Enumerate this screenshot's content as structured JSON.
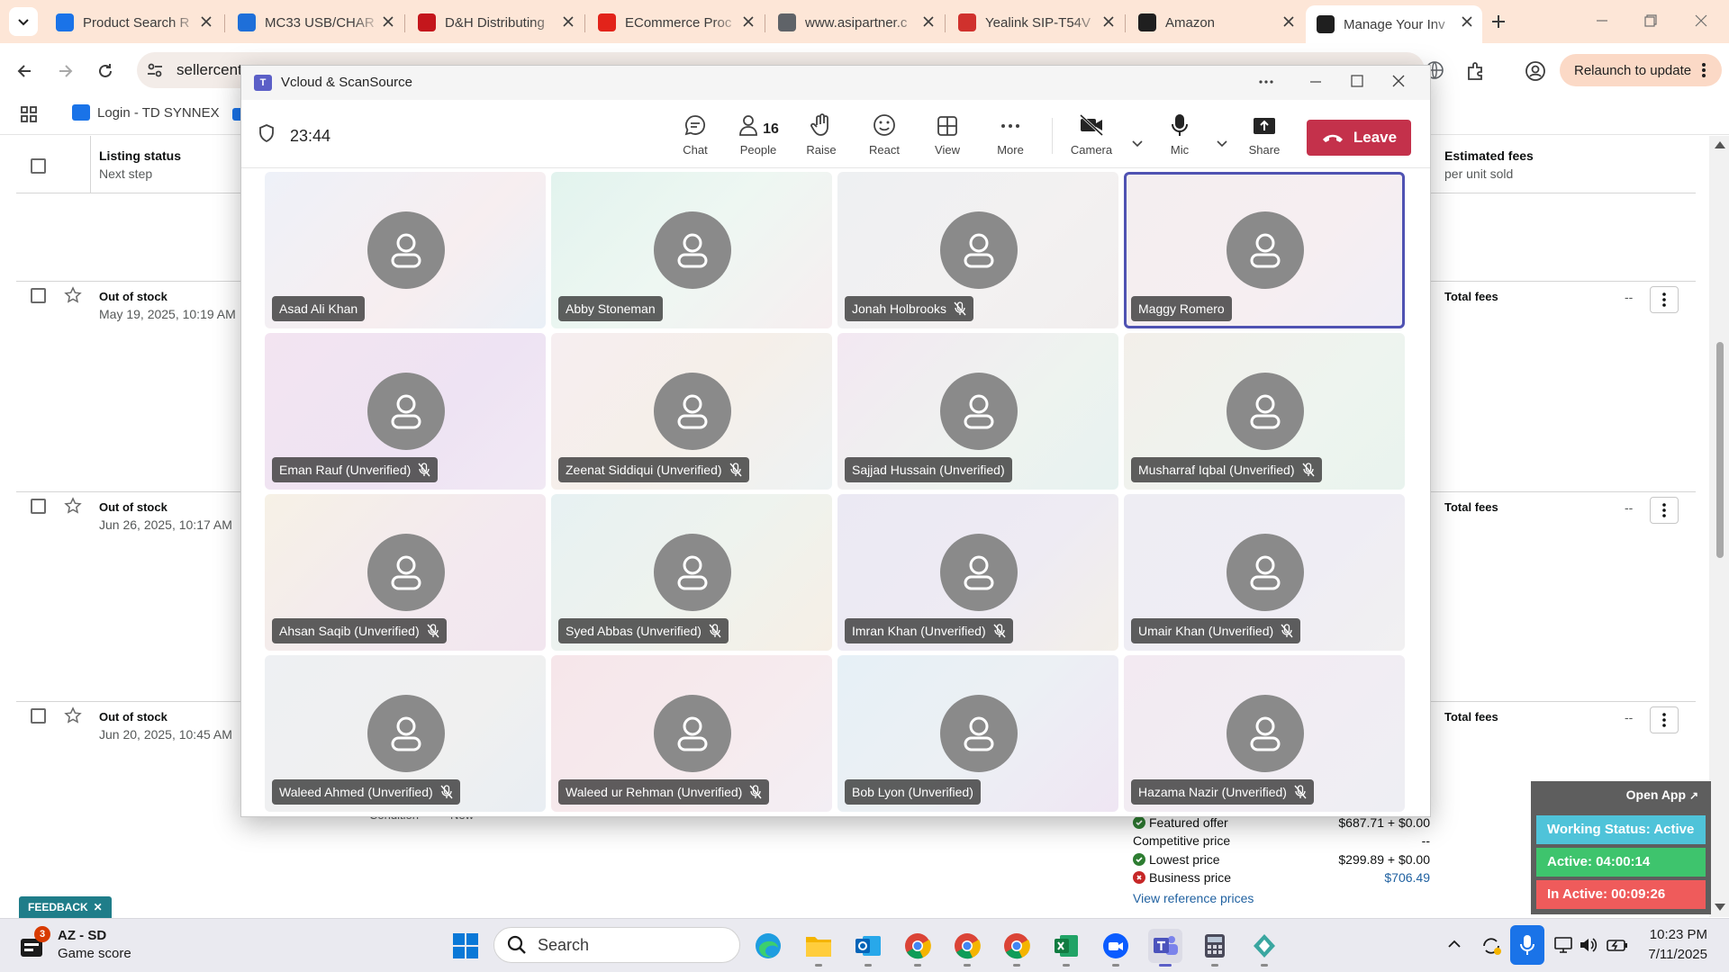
{
  "browser": {
    "tabs": [
      {
        "title": "Product Search R",
        "favicon": "ec-logo-icon",
        "color": "#1a73e8"
      },
      {
        "title": "MC33 USB/CHAR",
        "favicon": "zebra-icon",
        "color": "#1e6fd9"
      },
      {
        "title": "D&H Distributing",
        "favicon": "dh-icon",
        "color": "#c4161c"
      },
      {
        "title": "ECommerce Proc",
        "favicon": "scansource-icon",
        "color": "#e2231a"
      },
      {
        "title": "www.asipartner.c",
        "favicon": "globe-icon",
        "color": "#5f6368"
      },
      {
        "title": "Yealink SIP-T54V",
        "favicon": "yealink-icon",
        "color": "#d0312d"
      },
      {
        "title": "Amazon",
        "favicon": "amazon-icon",
        "color": "#1f1f1f"
      },
      {
        "title": "Manage Your Inv",
        "favicon": "amazon-icon",
        "color": "#1f1f1f"
      }
    ],
    "address": "sellercent",
    "relaunch_label": "Relaunch to update",
    "bookmarks": [
      {
        "label": "Login - TD SYNNEX"
      }
    ]
  },
  "page": {
    "header": {
      "listing_status": "Listing status",
      "next_step": "Next step",
      "estimated_fees": "Estimated fees",
      "per_unit": "per unit sold"
    },
    "rows": [
      {
        "status": "Out of stock",
        "date": "May 19, 2025, 10:19 AM",
        "fees": "Total fees",
        "dash": "--"
      },
      {
        "status": "Out of stock",
        "date": "Jun 26, 2025, 10:17 AM",
        "fees": "Total fees",
        "dash": "--"
      },
      {
        "status": "Out of stock",
        "date": "Jun 20, 2025, 10:45 AM",
        "fees": "Total fees",
        "dash": "--"
      }
    ],
    "condition_label": "Condition",
    "condition_value": "New",
    "prices": {
      "featured_label": "Featured offer",
      "featured_value": "$687.71 + $0.00",
      "competitive_label": "Competitive price",
      "competitive_value": "--",
      "lowest_label": "Lowest price",
      "lowest_value": "$299.89 + $0.00",
      "business_label": "Business price",
      "business_value": "$706.49",
      "reference_link": "View reference prices"
    },
    "feedback_label": "FEEDBACK"
  },
  "tracker": {
    "open_app": "Open App",
    "working_status": "Working Status: Active",
    "active": "Active: 04:00:14",
    "inactive": "In Active: 00:09:26",
    "colors": {
      "status": "#4fc3d9",
      "active": "#3ec46d",
      "inactive": "#ef5b5b"
    }
  },
  "teams": {
    "window_title": "Vcloud & ScanSource",
    "timer": "23:44",
    "toolbar": {
      "chat": "Chat",
      "people": "People",
      "people_count": "16",
      "raise": "Raise",
      "react": "React",
      "view": "View",
      "more": "More",
      "camera": "Camera",
      "mic": "Mic",
      "share": "Share",
      "leave": "Leave"
    },
    "participants": [
      {
        "name": "Asad Ali Khan",
        "muted": false,
        "selected": false,
        "bg": "linear-gradient(135deg,#eef1f8,#f7eef0 60%,#eaf0f7)"
      },
      {
        "name": "Abby Stoneman",
        "muted": false,
        "selected": false,
        "bg": "linear-gradient(135deg,#e2f3ee,#eef7f2 50%,#f6eef0)"
      },
      {
        "name": "Jonah Holbrooks",
        "muted": true,
        "selected": false,
        "bg": "linear-gradient(135deg,#eef0f2,#f3f1f1 60%,#f1eeee)"
      },
      {
        "name": "Maggy Romero",
        "muted": false,
        "selected": true,
        "bg": "linear-gradient(135deg,#f4eef0,#f6eef1 60%,#f0eef6)"
      },
      {
        "name": "Eman Rauf (Unverified)",
        "muted": true,
        "selected": false,
        "bg": "linear-gradient(135deg,#f3e4f1,#eee3f3 60%,#f1e9f4)"
      },
      {
        "name": "Zeenat Siddiqui (Unverified)",
        "muted": true,
        "selected": false,
        "bg": "linear-gradient(135deg,#f6eef0,#f5efe9 50%,#eef2f3)"
      },
      {
        "name": "Sajjad Hussain (Unverified)",
        "muted": false,
        "selected": false,
        "bg": "linear-gradient(135deg,#f3e8f2,#eef3ef 60%,#e7f2f0)"
      },
      {
        "name": "Musharraf Iqbal (Unverified)",
        "muted": true,
        "selected": false,
        "bg": "linear-gradient(135deg,#f3efea,#eef4ef 60%,#e9f3ee)"
      },
      {
        "name": "Ahsan Saqib (Unverified)",
        "muted": true,
        "selected": false,
        "bg": "linear-gradient(135deg,#f6f1e6,#f3e9ef 60%,#f2e6ef)"
      },
      {
        "name": "Syed Abbas (Unverified)",
        "muted": true,
        "selected": false,
        "bg": "linear-gradient(135deg,#e7f1f2,#eef3ee 50%,#f6efe6)"
      },
      {
        "name": "Imran Khan (Unverified)",
        "muted": true,
        "selected": false,
        "bg": "linear-gradient(135deg,#ebe9f3,#eeebf3 60%,#f3efe9)"
      },
      {
        "name": "Umair Khan (Unverified)",
        "muted": true,
        "selected": false,
        "bg": "linear-gradient(135deg,#eeedf3,#efedf4 60%,#f1f0f1)"
      },
      {
        "name": "Waleed Ahmed (Unverified)",
        "muted": true,
        "selected": false,
        "bg": "linear-gradient(135deg,#eef0f3,#f0f0f0 60%,#e9eef3)"
      },
      {
        "name": "Waleed ur Rehman (Unverified)",
        "muted": true,
        "selected": false,
        "bg": "linear-gradient(135deg,#f6e6ea,#f6ebee 60%,#f3eef4)"
      },
      {
        "name": "Bob Lyon (Unverified)",
        "muted": false,
        "selected": false,
        "bg": "linear-gradient(135deg,#e6f0f6,#ecf0f4 50%,#efe6f3)"
      },
      {
        "name": "Hazama Nazir (Unverified)",
        "muted": true,
        "selected": false,
        "bg": "linear-gradient(135deg,#f3eaf2,#f1edf3 60%,#eeeef3)"
      }
    ]
  },
  "taskbar": {
    "weather_badge": "3",
    "weather_title": "AZ - SD",
    "weather_sub": "Game score",
    "search_label": "Search",
    "time": "10:23 PM",
    "date": "7/11/2025"
  }
}
